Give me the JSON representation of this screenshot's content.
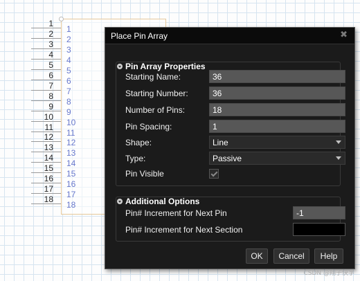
{
  "canvas": {
    "pin_numbers": [
      "1",
      "2",
      "3",
      "4",
      "5",
      "6",
      "7",
      "8",
      "9",
      "10",
      "11",
      "12",
      "13",
      "14",
      "15",
      "16",
      "17",
      "18"
    ],
    "pin_names": [
      "1",
      "2",
      "3",
      "4",
      "5",
      "6",
      "7",
      "8",
      "9",
      "10",
      "11",
      "12",
      "13",
      "14",
      "15",
      "16",
      "17",
      "18"
    ]
  },
  "dialog": {
    "title": "Place Pin Array",
    "close_icon": "close-icon",
    "pin_array_properties": {
      "title": "Pin Array Properties",
      "starting_name": {
        "label": "Starting Name:",
        "value": "36"
      },
      "starting_number": {
        "label": "Starting Number:",
        "value": "36"
      },
      "number_of_pins": {
        "label": "Number of Pins:",
        "value": "18"
      },
      "pin_spacing": {
        "label": "Pin Spacing:",
        "value": "1"
      },
      "shape": {
        "label": "Shape:",
        "value": "Line"
      },
      "type": {
        "label": "Type:",
        "value": "Passive"
      },
      "pin_visible": {
        "label": "Pin Visible",
        "checked": true
      }
    },
    "additional_options": {
      "title": "Additional Options",
      "increment_next_pin": {
        "label": "Pin# Increment for Next Pin",
        "value": "-1"
      },
      "increment_next_section": {
        "label": "Pin# Increment for Next Section",
        "value": ""
      }
    },
    "buttons": {
      "ok": "OK",
      "cancel": "Cancel",
      "help": "Help"
    }
  },
  "watermark": "CSDN @翔子快学"
}
